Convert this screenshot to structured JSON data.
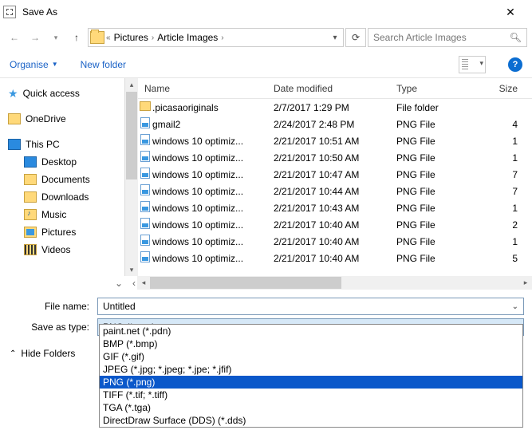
{
  "window": {
    "title": "Save As"
  },
  "nav": {
    "path_root_sep": "«",
    "crumb1": "Pictures",
    "crumb2": "Article Images",
    "search_placeholder": "Search Article Images"
  },
  "toolbar": {
    "organise": "Organise",
    "new_folder": "New folder"
  },
  "tree": {
    "quick": "Quick access",
    "onedrive": "OneDrive",
    "thispc": "This PC",
    "desktop": "Desktop",
    "documents": "Documents",
    "downloads": "Downloads",
    "music": "Music",
    "pictures": "Pictures",
    "videos": "Videos"
  },
  "columns": {
    "name": "Name",
    "date": "Date modified",
    "type": "Type",
    "size": "Size"
  },
  "rows": [
    {
      "icon": "folder",
      "name": ".picasaoriginals",
      "date": "2/7/2017 1:29 PM",
      "type": "File folder",
      "size": ""
    },
    {
      "icon": "png",
      "name": "gmail2",
      "date": "2/24/2017 2:48 PM",
      "type": "PNG File",
      "size": "4"
    },
    {
      "icon": "png",
      "name": "windows 10 optimiz...",
      "date": "2/21/2017 10:51 AM",
      "type": "PNG File",
      "size": "1"
    },
    {
      "icon": "png",
      "name": "windows 10 optimiz...",
      "date": "2/21/2017 10:50 AM",
      "type": "PNG File",
      "size": "1"
    },
    {
      "icon": "png",
      "name": "windows 10 optimiz...",
      "date": "2/21/2017 10:47 AM",
      "type": "PNG File",
      "size": "7"
    },
    {
      "icon": "png",
      "name": "windows 10 optimiz...",
      "date": "2/21/2017 10:44 AM",
      "type": "PNG File",
      "size": "7"
    },
    {
      "icon": "png",
      "name": "windows 10 optimiz...",
      "date": "2/21/2017 10:43 AM",
      "type": "PNG File",
      "size": "1"
    },
    {
      "icon": "png",
      "name": "windows 10 optimiz...",
      "date": "2/21/2017 10:40 AM",
      "type": "PNG File",
      "size": "2"
    },
    {
      "icon": "png",
      "name": "windows 10 optimiz...",
      "date": "2/21/2017 10:40 AM",
      "type": "PNG File",
      "size": "1"
    },
    {
      "icon": "png",
      "name": "windows 10 optimiz...",
      "date": "2/21/2017 10:40 AM",
      "type": "PNG File",
      "size": "5"
    }
  ],
  "form": {
    "filename_label": "File name:",
    "filename_value": "Untitled",
    "type_label": "Save as type:",
    "type_value": "PNG (*.png)"
  },
  "dropdown": [
    "paint.net (*.pdn)",
    "BMP (*.bmp)",
    "GIF (*.gif)",
    "JPEG (*.jpg; *.jpeg; *.jpe; *.jfif)",
    "PNG (*.png)",
    "TIFF (*.tif; *.tiff)",
    "TGA (*.tga)",
    "DirectDraw Surface (DDS) (*.dds)"
  ],
  "dropdown_selected_index": 4,
  "footer": {
    "hide": "Hide Folders"
  }
}
